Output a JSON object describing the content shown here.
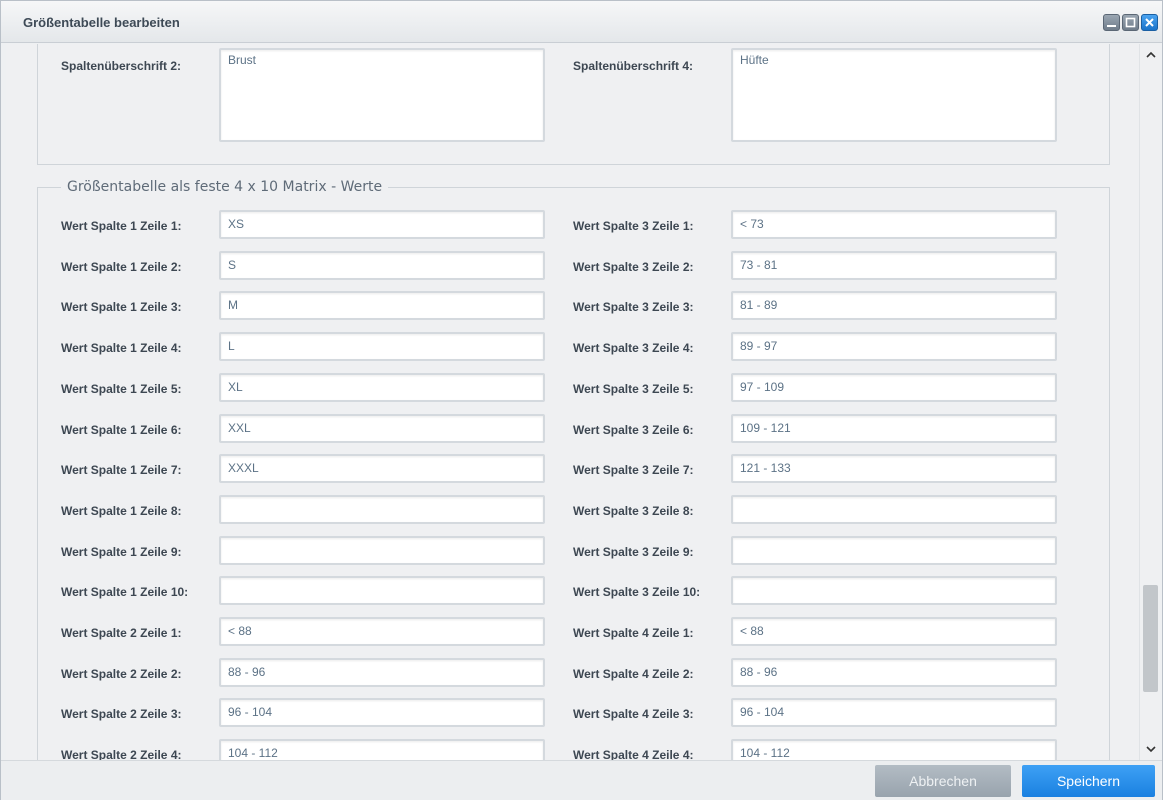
{
  "window": {
    "title": "Größentabelle bearbeiten"
  },
  "header_fields": [
    {
      "label": "Spaltenüberschrift 2:",
      "value": "Brust"
    },
    {
      "label": "Spaltenüberschrift 4:",
      "value": "Hüfte"
    }
  ],
  "matrix": {
    "legend": "Größentabelle als feste 4 x 10 Matrix - Werte",
    "left": [
      {
        "label": "Wert Spalte 1 Zeile 1:",
        "value": "XS"
      },
      {
        "label": "Wert Spalte 1 Zeile 2:",
        "value": "S"
      },
      {
        "label": "Wert Spalte 1 Zeile 3:",
        "value": "M"
      },
      {
        "label": "Wert Spalte 1 Zeile 4:",
        "value": "L"
      },
      {
        "label": "Wert Spalte 1 Zeile 5:",
        "value": "XL"
      },
      {
        "label": "Wert Spalte 1 Zeile 6:",
        "value": "XXL"
      },
      {
        "label": "Wert Spalte 1 Zeile 7:",
        "value": "XXXL"
      },
      {
        "label": "Wert Spalte 1 Zeile 8:",
        "value": ""
      },
      {
        "label": "Wert Spalte 1 Zeile 9:",
        "value": ""
      },
      {
        "label": "Wert Spalte 1 Zeile 10:",
        "value": ""
      },
      {
        "label": "Wert Spalte 2 Zeile 1:",
        "value": "< 88"
      },
      {
        "label": "Wert Spalte 2 Zeile 2:",
        "value": "88 - 96"
      },
      {
        "label": "Wert Spalte 2 Zeile 3:",
        "value": "96 - 104"
      },
      {
        "label": "Wert Spalte 2 Zeile 4:",
        "value": "104 - 112"
      }
    ],
    "right": [
      {
        "label": "Wert Spalte 3 Zeile 1:",
        "value": "< 73"
      },
      {
        "label": "Wert Spalte 3 Zeile 2:",
        "value": "73 - 81"
      },
      {
        "label": "Wert Spalte 3 Zeile 3:",
        "value": "81 - 89"
      },
      {
        "label": "Wert Spalte 3 Zeile 4:",
        "value": "89 - 97"
      },
      {
        "label": "Wert Spalte 3 Zeile 5:",
        "value": "97 - 109"
      },
      {
        "label": "Wert Spalte 3 Zeile 6:",
        "value": "109 - 121"
      },
      {
        "label": "Wert Spalte 3 Zeile 7:",
        "value": "121 - 133"
      },
      {
        "label": "Wert Spalte 3 Zeile 8:",
        "value": ""
      },
      {
        "label": "Wert Spalte 3 Zeile 9:",
        "value": ""
      },
      {
        "label": "Wert Spalte 3 Zeile 10:",
        "value": ""
      },
      {
        "label": "Wert Spalte 4 Zeile 1:",
        "value": "< 88"
      },
      {
        "label": "Wert Spalte 4 Zeile 2:",
        "value": "88 - 96"
      },
      {
        "label": "Wert Spalte 4 Zeile 3:",
        "value": "96 - 104"
      },
      {
        "label": "Wert Spalte 4 Zeile 4:",
        "value": "104 - 112"
      }
    ]
  },
  "footer": {
    "cancel_label": "Abbrechen",
    "save_label": "Speichern"
  },
  "icons": {
    "minimize": "minimize-icon",
    "maximize": "maximize-icon",
    "close": "close-icon",
    "scroll_up": "chevron-up-icon",
    "scroll_down": "chevron-down-icon"
  },
  "colors": {
    "save_button": "#1a80e0",
    "cancel_button": "#98a3ad",
    "input_text": "#5c7286"
  }
}
